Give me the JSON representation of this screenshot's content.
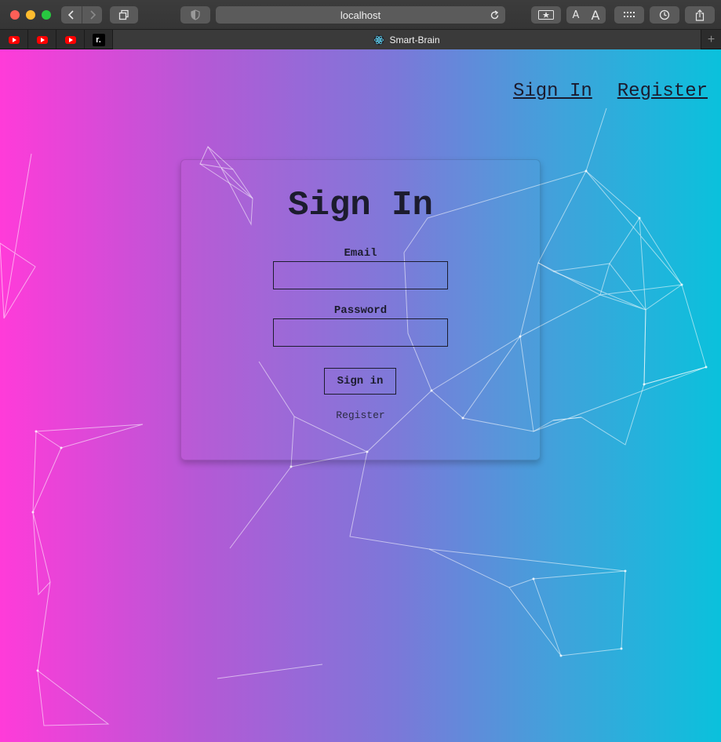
{
  "browser": {
    "url": "localhost",
    "active_tab_title": "Smart-Brain",
    "pinned_tabs": [
      {
        "icon": "youtube-icon"
      },
      {
        "icon": "youtube-icon"
      },
      {
        "icon": "youtube-icon"
      },
      {
        "icon": "r-logo-icon",
        "glyph": "r."
      }
    ],
    "reader_small": "A",
    "reader_large": "A",
    "new_tab_glyph": "+"
  },
  "nav": {
    "signin_label": "Sign In",
    "register_label": "Register"
  },
  "form": {
    "title": "Sign In",
    "email_label": "Email",
    "email_value": "",
    "password_label": "Password",
    "password_value": "",
    "submit_label": "Sign in",
    "register_link": "Register"
  },
  "colors": {
    "gradient_left": "#ff3bd9",
    "gradient_right": "#0ac1dc",
    "text_dark": "#1c1c2e"
  }
}
